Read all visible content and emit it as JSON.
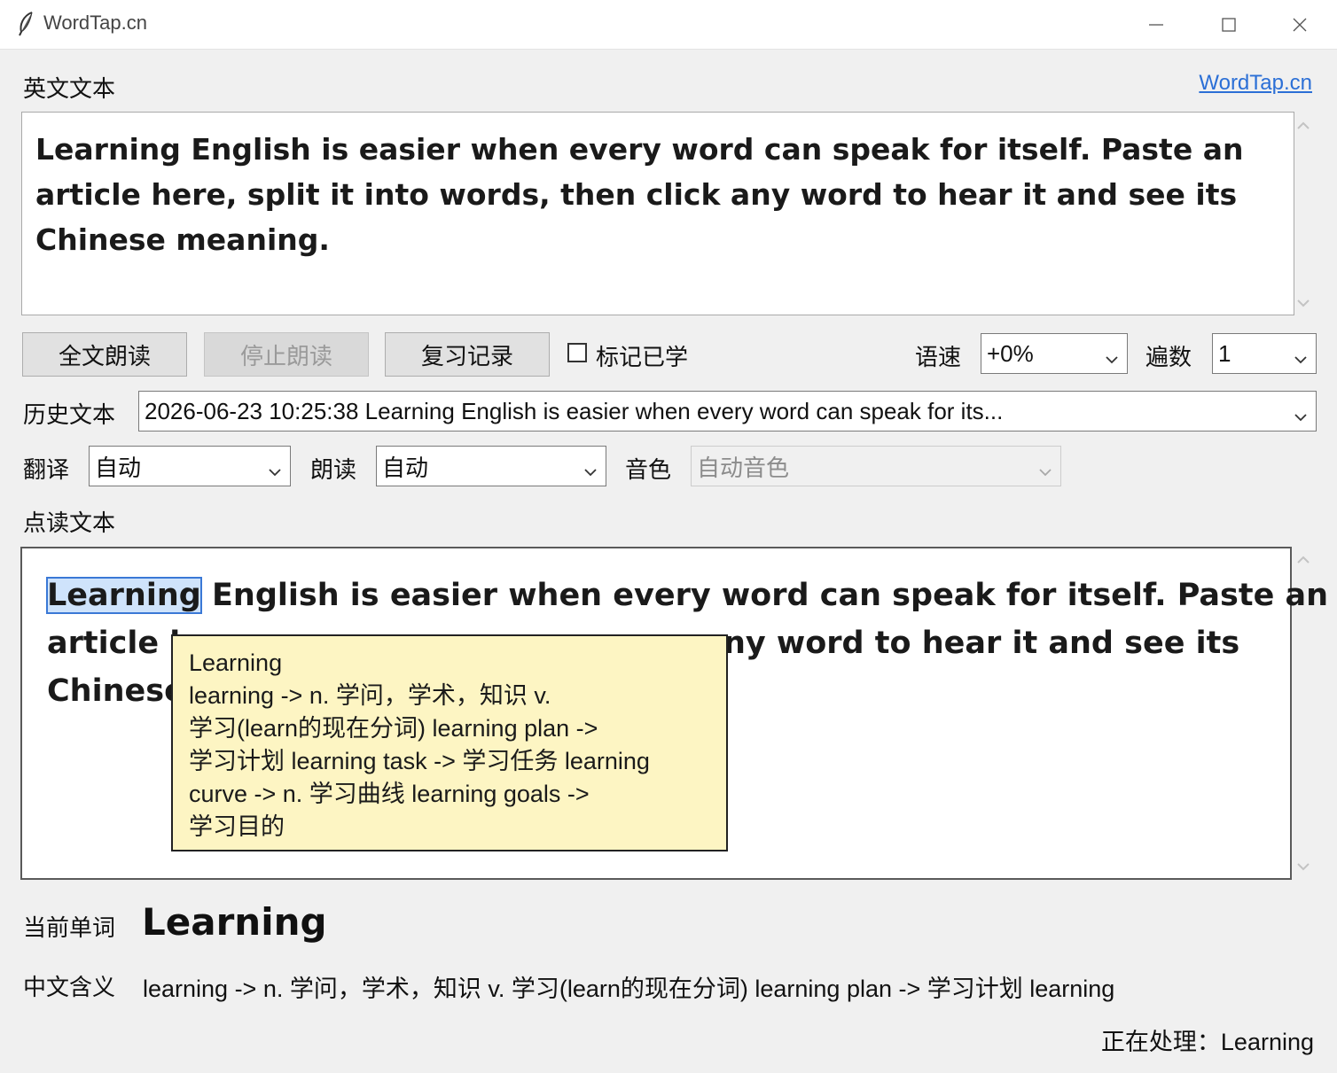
{
  "window": {
    "title": "WordTap.cn"
  },
  "header": {
    "english_label": "英文文本",
    "site_link": "WordTap.cn"
  },
  "english_text": "Learning English is easier when every word can speak for itself. Paste an article here, split it into words, then click any word to hear it and see its Chinese meaning.",
  "toolbar": {
    "read_all": "全文朗读",
    "stop_reading": "停止朗读",
    "review_history": "复习记录",
    "mark_learned": "标记已学",
    "mark_learned_checked": false,
    "speed_label": "语速",
    "speed_value": "+0%",
    "repeat_label": "遍数",
    "repeat_value": "1"
  },
  "history": {
    "label": "历史文本",
    "selected": "2026-06-23 10:25:38  Learning English is easier when every word can speak for its..."
  },
  "options": {
    "translate_label": "翻译",
    "translate_value": "自动",
    "read_label": "朗读",
    "read_value": "自动",
    "voice_label": "音色",
    "voice_value": "自动音色"
  },
  "reading": {
    "label": "点读文本",
    "selected_word": "Learning",
    "line1_rest": " English is easier when every word can speak for itself. Paste an",
    "line2_start": "article h",
    "line2_end": "ny word to hear it and see its",
    "line3_start": "Chinese"
  },
  "tooltip": {
    "lines": [
      "Learning",
      "learning -> n. 学问，学术，知识 v.",
      "学习(learn的现在分词)  learning plan ->",
      "学习计划  learning task -> 学习任务  learning",
      "curve -> n. 学习曲线  learning goals ->",
      "学习目的"
    ]
  },
  "current": {
    "label": "当前单词",
    "word": "Learning",
    "meaning_label": "中文含义",
    "meaning": "learning -> n. 学问，学术，知识 v. 学习(learn的现在分词)  learning plan -> 学习计划  learning"
  },
  "status": {
    "text": "正在处理：Learning"
  }
}
